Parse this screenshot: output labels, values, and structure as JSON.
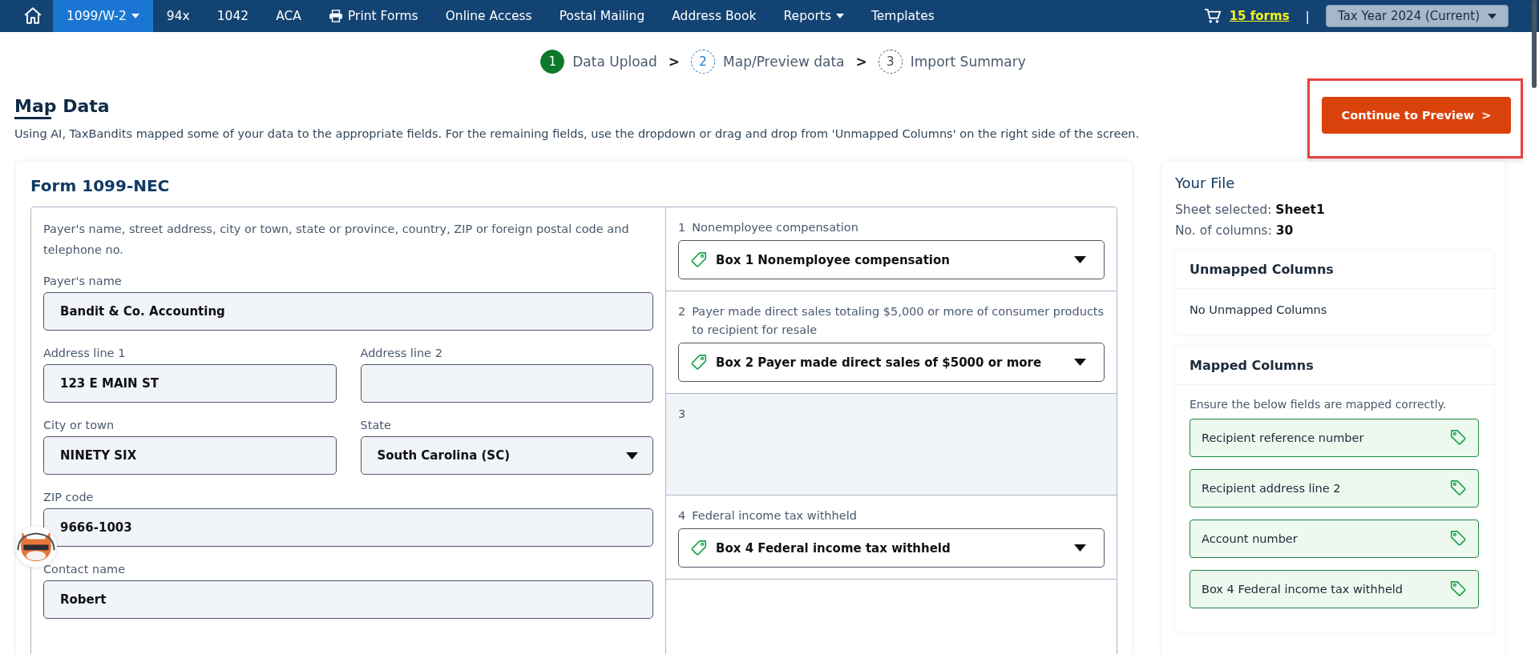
{
  "nav": {
    "items": [
      {
        "label": "1099/W-2",
        "kind": "menu",
        "selected": true
      },
      {
        "label": "94x",
        "kind": "plain",
        "selected": false
      },
      {
        "label": "1042",
        "kind": "plain",
        "selected": false
      },
      {
        "label": "ACA",
        "kind": "plain",
        "selected": false
      },
      {
        "label": "Print Forms",
        "kind": "with-icon",
        "selected": false
      },
      {
        "label": "Online Access",
        "kind": "plain",
        "selected": false
      },
      {
        "label": "Postal Mailing",
        "kind": "plain",
        "selected": false
      },
      {
        "label": "Address Book",
        "kind": "plain",
        "selected": false
      },
      {
        "label": "Reports",
        "kind": "menu",
        "selected": false
      },
      {
        "label": "Templates",
        "kind": "plain",
        "selected": false
      }
    ],
    "cart_link": "15 forms",
    "separator": "|",
    "tax_year": "Tax Year 2024 (Current)"
  },
  "steps": [
    {
      "number": "1",
      "label": "Data Upload",
      "completed": true,
      "selected": false,
      "separator": ">"
    },
    {
      "number": "2",
      "label": "Map/Preview data",
      "completed": false,
      "selected": true,
      "separator": ">"
    },
    {
      "number": "3",
      "label": "Import Summary",
      "completed": false,
      "selected": false
    }
  ],
  "page": {
    "title": "Map Data",
    "description": "Using AI, TaxBandits mapped some of your data to the appropriate fields. For the remaining fields, use the dropdown or drag and drop from 'Unmapped Columns' on the right side of the screen.",
    "continue_button": "Continue to Preview",
    "continue_caret": ">",
    "highlighted": true
  },
  "form": {
    "title": "Form 1099-NEC",
    "payer_description": "Payer's name, street address, city or town, state or province, country, ZIP or foreign postal code and telephone no.",
    "rows": [
      {
        "fields": [
          {
            "label": "Payer's name",
            "kind": "text",
            "value": "Bandit & Co. Accounting"
          }
        ]
      },
      {
        "fields": [
          {
            "label": "Address line 1",
            "kind": "text",
            "value": "123 E MAIN ST"
          },
          {
            "label": "Address line 2",
            "kind": "text"
          }
        ]
      },
      {
        "fields": [
          {
            "label": "City or town",
            "kind": "text",
            "value": "NINETY SIX"
          },
          {
            "label": "State",
            "kind": "select",
            "value": "South Carolina (SC)"
          }
        ]
      },
      {
        "fields": [
          {
            "label": "ZIP code",
            "kind": "text",
            "value": "9666-1003"
          }
        ]
      },
      {
        "fields": [
          {
            "label": "Contact name",
            "kind": "text",
            "value": "Robert"
          }
        ]
      }
    ],
    "boxes": [
      {
        "number": "1",
        "label": "Nonemployee compensation",
        "mapped": "Box 1 Nonemployee compensation",
        "disabled": false
      },
      {
        "number": "2",
        "label": "Payer made direct sales totaling $5,000 or more of consumer products to recipient for resale",
        "mapped": "Box 2 Payer made direct sales of $5000 or more",
        "disabled": false
      },
      {
        "number": "3",
        "disabled": true
      },
      {
        "number": "4",
        "label": "Federal income tax withheld",
        "mapped": "Box 4 Federal income tax withheld",
        "disabled": false
      }
    ]
  },
  "your_file": {
    "title": "Your File",
    "sheet_label": "Sheet selected:",
    "sheet": "Sheet1",
    "columns_label": "No. of columns:",
    "columns": "30",
    "unmapped": {
      "title": "Unmapped Columns",
      "empty_text": "No Unmapped Columns"
    },
    "mapped": {
      "title": "Mapped Columns",
      "note": "Ensure the below fields are mapped correctly.",
      "items": [
        "Recipient reference number",
        "Recipient address line 2",
        "Account number",
        "Box 4 Federal income tax withheld"
      ]
    }
  }
}
